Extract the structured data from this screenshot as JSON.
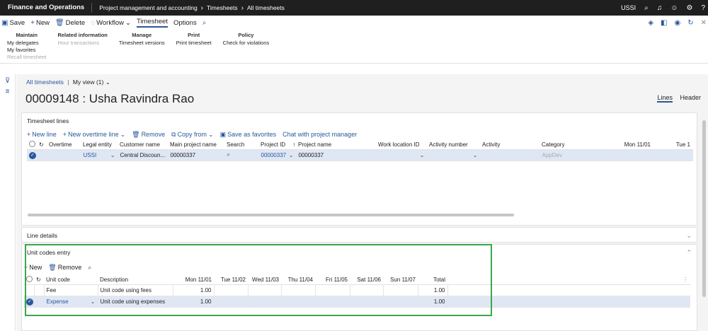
{
  "topbar": {
    "app_name": "Finance and Operations",
    "breadcrumbs": [
      "Project management and accounting",
      "Timesheets",
      "All timesheets"
    ],
    "company": "USSI"
  },
  "actions": {
    "save": "Save",
    "new": "New",
    "delete": "Delete",
    "workflow": "Workflow",
    "timesheet": "Timesheet",
    "options": "Options"
  },
  "ribbon": {
    "groups": [
      {
        "title": "Maintain",
        "items": [
          "My delegates",
          "My favorites",
          "Recall timesheet"
        ]
      },
      {
        "title": "Related information",
        "items": [
          "Hour transactions"
        ]
      },
      {
        "title": "Manage",
        "items": [
          "Timesheet versions"
        ]
      },
      {
        "title": "Print",
        "items": [
          "Print timesheet"
        ]
      },
      {
        "title": "Policy",
        "items": [
          "Check for violations"
        ]
      }
    ]
  },
  "page": {
    "breadcrumb_all": "All timesheets",
    "view": "My view (1)",
    "title": "00009148 : Usha Ravindra Rao",
    "tab_lines": "Lines",
    "tab_header": "Header"
  },
  "timesheet_lines": {
    "title": "Timesheet lines",
    "toolbar": [
      "New line",
      "New overtime line",
      "Remove",
      "Copy from",
      "Save as favorites",
      "Chat with project manager"
    ],
    "columns": [
      "Overtime",
      "Legal entity",
      "Customer name",
      "Main project name",
      "Search",
      "Project ID",
      "Project name",
      "Work location ID",
      "Activity number",
      "Activity",
      "Category",
      "Mon 11/01",
      "Tue 1"
    ],
    "row": {
      "legal_entity": "USSI",
      "customer": "Central Discoun...",
      "main_project": "00000337",
      "project_id": "00000337",
      "project_name": "00000337",
      "category": "AppDev"
    }
  },
  "line_details": {
    "title": "Line details"
  },
  "unit_codes": {
    "title": "Unit codes entry",
    "toolbar": [
      "New",
      "Remove"
    ],
    "columns": [
      "Unit code",
      "Description",
      "Mon 11/01",
      "Tue 11/02",
      "Wed 11/03",
      "Thu 11/04",
      "Fri 11/05",
      "Sat 11/06",
      "Sun 11/07",
      "Total"
    ],
    "rows": [
      {
        "code": "Fee",
        "desc": "Unit code using fees",
        "mon": "1.00",
        "total": "1.00"
      },
      {
        "code": "Expense",
        "desc": "Unit code using expenses",
        "mon": "1.00",
        "total": "1.00"
      }
    ]
  },
  "colors": {
    "accent": "#2b579a",
    "highlight_box": "#3aa84a",
    "selected_row": "#dfe7f5"
  }
}
